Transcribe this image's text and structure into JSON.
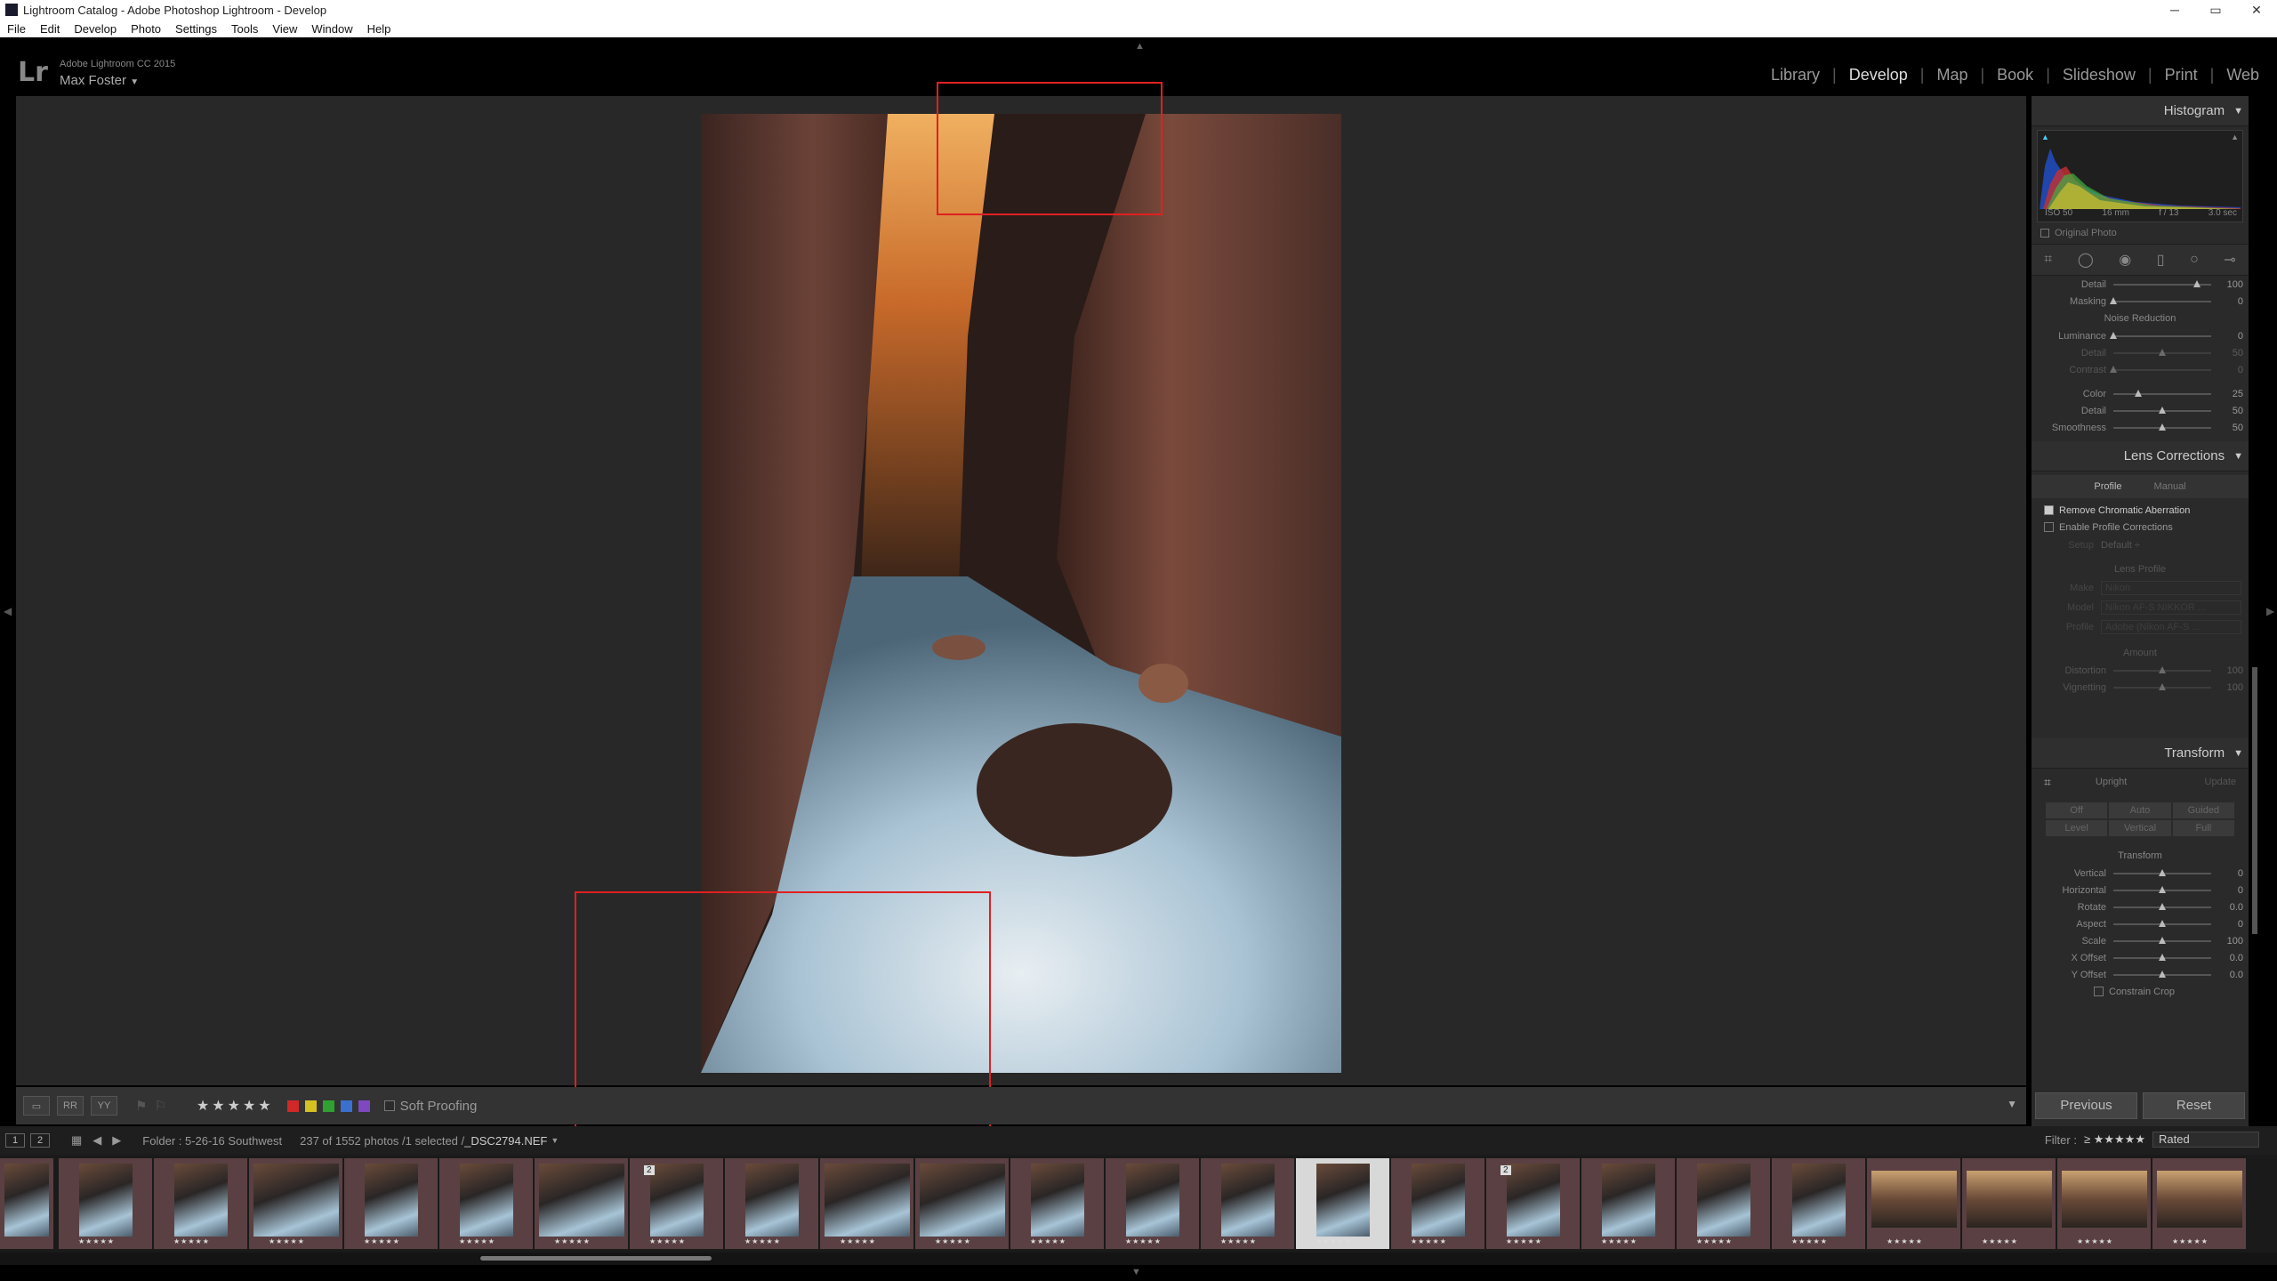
{
  "window": {
    "title": "Lightroom Catalog - Adobe Photoshop Lightroom - Develop"
  },
  "menu": [
    "File",
    "Edit",
    "Develop",
    "Photo",
    "Settings",
    "Tools",
    "View",
    "Window",
    "Help"
  ],
  "identity": {
    "logo": "Lr",
    "app": "Adobe Lightroom CC 2015",
    "user": "Max Foster"
  },
  "modules": [
    "Library",
    "Develop",
    "Map",
    "Book",
    "Slideshow",
    "Print",
    "Web"
  ],
  "active_module": "Develop",
  "toolbar": {
    "stars": "★★★★★",
    "soft_proofing": "Soft Proofing",
    "colors": [
      "#d02828",
      "#d4c020",
      "#30a030",
      "#3a70d0",
      "#8048c0"
    ]
  },
  "histogram": {
    "title": "Histogram",
    "iso": "ISO 50",
    "focal": "16 mm",
    "aperture": "f / 13",
    "shutter": "3.0 sec",
    "original_photo": "Original Photo"
  },
  "detail": {
    "sharpen": [
      {
        "label": "Detail",
        "value": "100",
        "pos": 0.85
      },
      {
        "label": "Masking",
        "value": "0",
        "pos": 0
      }
    ],
    "noise_title": "Noise Reduction",
    "noise_luma": [
      {
        "label": "Luminance",
        "value": "0",
        "pos": 0
      },
      {
        "label": "Detail",
        "value": "50",
        "pos": 0.5,
        "dim": true
      },
      {
        "label": "Contrast",
        "value": "0",
        "pos": 0,
        "dim": true
      }
    ],
    "noise_color": [
      {
        "label": "Color",
        "value": "25",
        "pos": 0.25
      },
      {
        "label": "Detail",
        "value": "50",
        "pos": 0.5
      },
      {
        "label": "Smoothness",
        "value": "50",
        "pos": 0.5
      }
    ]
  },
  "lens": {
    "title": "Lens Corrections",
    "tabs": [
      "Profile",
      "Manual"
    ],
    "remove_ca": "Remove Chromatic Aberration",
    "enable_profile": "Enable Profile Corrections",
    "setup_label": "Setup",
    "setup_value": "Default ÷",
    "lens_profile": "Lens Profile",
    "make_label": "Make",
    "make_value": "Nikon",
    "model_label": "Model",
    "model_value": "Nikon AF-S NIKKOR ...",
    "profile_label": "Profile",
    "profile_value": "Adobe (Nikon AF-S ...",
    "amount": "Amount",
    "amount_sliders": [
      {
        "label": "Distortion",
        "value": "100",
        "pos": 0.5
      },
      {
        "label": "Vignetting",
        "value": "100",
        "pos": 0.5
      }
    ]
  },
  "transform": {
    "title": "Transform",
    "upright": "Upright",
    "update": "Update",
    "buttons": [
      "Off",
      "Auto",
      "Guided",
      "Level",
      "Vertical",
      "Full"
    ],
    "sub": "Transform",
    "sliders": [
      {
        "label": "Vertical",
        "value": "0",
        "pos": 0.5
      },
      {
        "label": "Horizontal",
        "value": "0",
        "pos": 0.5
      },
      {
        "label": "Rotate",
        "value": "0.0",
        "pos": 0.5
      },
      {
        "label": "Aspect",
        "value": "0",
        "pos": 0.5
      },
      {
        "label": "Scale",
        "value": "100",
        "pos": 0.5
      },
      {
        "label": "X Offset",
        "value": "0.0",
        "pos": 0.5
      },
      {
        "label": "Y Offset",
        "value": "0.0",
        "pos": 0.5
      }
    ],
    "constrain": "Constrain Crop"
  },
  "panel_buttons": {
    "previous": "Previous",
    "reset": "Reset"
  },
  "filmbar": {
    "view1": "1",
    "view2": "2",
    "folder": "Folder : 5-26-16 Southwest",
    "count": "237 of 1552 photos /1 selected /",
    "file": "_DSC2794.NEF",
    "filter_label": "Filter :",
    "filter_stars": "≥ ★★★★★",
    "rated": "Rated"
  },
  "filmstrip": {
    "thumbs": [
      {
        "stars": "★★★★★"
      },
      {
        "stars": "★★★★★"
      },
      {
        "stars": "★★★★★"
      },
      {
        "stars": "★★★★★"
      },
      {
        "stars": "★★★★★"
      },
      {
        "stars": "★★★★★"
      },
      {
        "stars": "★★★★★",
        "badge": "2"
      },
      {
        "stars": "★★★★★"
      },
      {
        "stars": "★★★★★"
      },
      {
        "stars": "★★★★★"
      },
      {
        "stars": "★★★★★"
      },
      {
        "stars": "★★★★★"
      },
      {
        "stars": "★★★★★"
      },
      {
        "stars": "★★★★★",
        "selected": true
      },
      {
        "stars": "★★★★★"
      },
      {
        "stars": "★★★★★",
        "badge": "2"
      },
      {
        "stars": "★★★★★"
      },
      {
        "stars": "★★★★★"
      },
      {
        "stars": "★★★★★"
      },
      {
        "stars": "★★★★★"
      },
      {
        "stars": "★★★★★"
      },
      {
        "stars": "★★★★★"
      },
      {
        "stars": "★★★★★"
      }
    ]
  }
}
